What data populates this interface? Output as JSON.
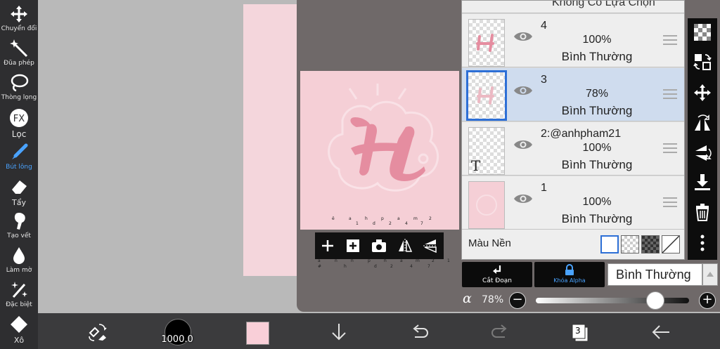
{
  "left_toolbar": {
    "tools": [
      {
        "label": "Chuyển đổi",
        "icon": "move-icon"
      },
      {
        "label": "Đũa phép",
        "icon": "magic-wand-icon"
      },
      {
        "label": "Thòng lọng",
        "icon": "lasso-icon"
      },
      {
        "label": "Lọc",
        "icon": "fx-filter-icon"
      },
      {
        "label": "Bút lông",
        "icon": "brush-icon",
        "active": true
      },
      {
        "label": "Tẩy",
        "icon": "eraser-icon"
      },
      {
        "label": "Tạo vết",
        "icon": "smudge-icon"
      },
      {
        "label": "Làm mờ",
        "icon": "blur-icon"
      },
      {
        "label": "Đặc biệt",
        "icon": "special-icon"
      },
      {
        "label": "Xô",
        "icon": "bucket-icon"
      }
    ]
  },
  "canvas": {
    "tiny_text_row1": [
      "ë",
      "a",
      "h",
      "p",
      "a",
      "m",
      "2"
    ],
    "tiny_text_row1b": [
      "1",
      "d",
      "2",
      "4",
      "7"
    ],
    "tiny_text_row2": [
      "a",
      "n",
      "h",
      "p",
      "h",
      "a",
      "m",
      "2",
      "1"
    ],
    "tiny_text_row2b": [
      "#",
      "h",
      "d",
      "2",
      "4",
      "7"
    ]
  },
  "layer_panel": {
    "top_cut_text": "Không Có Lựa Chọn",
    "layers": [
      {
        "name": "4",
        "opacity": "100%",
        "mode": "Bình Thường",
        "selected": false
      },
      {
        "name": "3",
        "opacity": "78%",
        "mode": "Bình Thường",
        "selected": true
      },
      {
        "name": "2:@anhpham21",
        "opacity": "100%",
        "mode": "Bình Thường",
        "selected": false,
        "thumb_text": "T"
      },
      {
        "name": "1",
        "opacity": "100%",
        "mode": "Bình Thường",
        "selected": false
      }
    ],
    "background_label": "Màu Nền"
  },
  "controls": {
    "clip_label": "Cắt Đoạn",
    "alpha_lock_label": "Khóa Alpha",
    "blend_mode": "Bình Thường",
    "alpha_symbol": "α",
    "alpha_value": "78%",
    "alpha_fraction": 0.78,
    "minus": "−",
    "plus": "+"
  },
  "bottom_bar": {
    "brush_size": "1000.0",
    "color": "#f9cfd8",
    "layer_count": "3"
  },
  "colors": {
    "accent": "#4aa3ff",
    "selection": "#2d6fd6",
    "canvas_pink": "#f5cfd6",
    "art_pink": "#e58da0"
  }
}
